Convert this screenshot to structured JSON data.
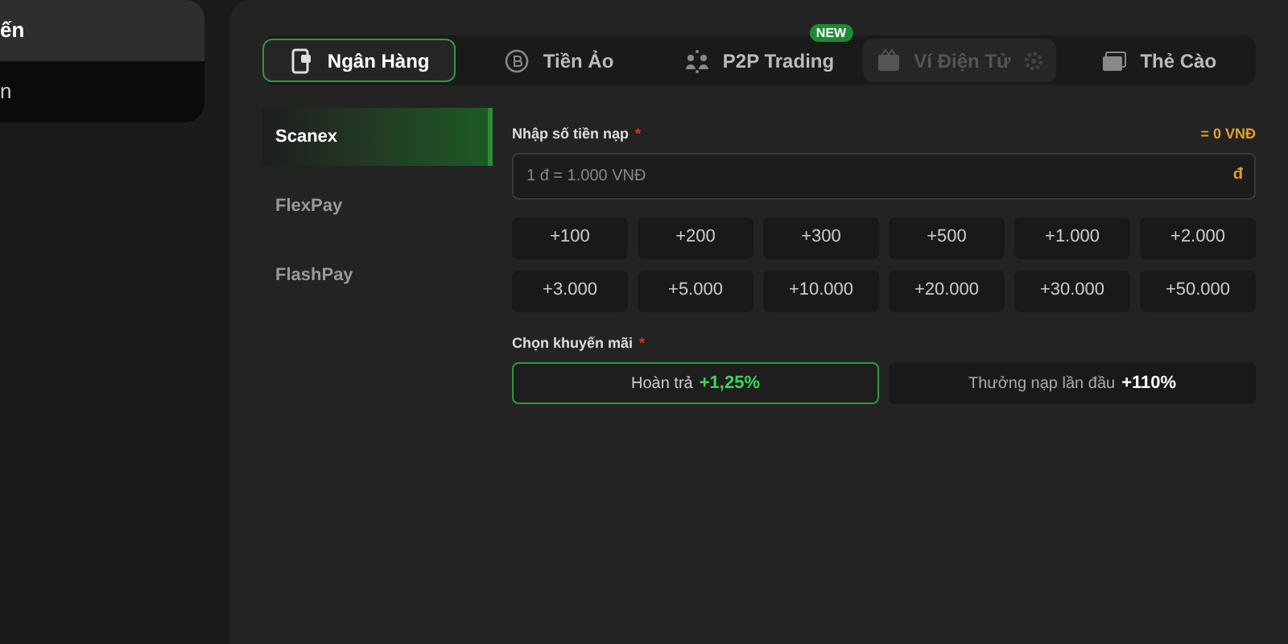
{
  "sidebar": {
    "items": [
      {
        "label": "ến",
        "selected": true
      },
      {
        "label": "n",
        "selected": false
      }
    ]
  },
  "tabs": [
    {
      "label": "Ngân Hàng",
      "selected": true,
      "disabled": false
    },
    {
      "label": "Tiền Ảo",
      "selected": false,
      "disabled": false
    },
    {
      "label": "P2P Trading",
      "selected": false,
      "disabled": false,
      "badge": "NEW"
    },
    {
      "label": "Ví Điện Tử",
      "selected": false,
      "disabled": true
    },
    {
      "label": "Thẻ Cào",
      "selected": false,
      "disabled": false
    }
  ],
  "methods": [
    {
      "label": "Scanex",
      "selected": true
    },
    {
      "label": "FlexPay",
      "selected": false
    },
    {
      "label": "FlashPay",
      "selected": false
    }
  ],
  "amount": {
    "label": "Nhập số tiền nạp",
    "required_mark": "*",
    "converted": "= 0 VNĐ",
    "placeholder": "1 đ = 1.000 VNĐ",
    "suffix": "đ"
  },
  "quick_amounts": [
    "+100",
    "+200",
    "+300",
    "+500",
    "+1.000",
    "+2.000",
    "+3.000",
    "+5.000",
    "+10.000",
    "+20.000",
    "+30.000",
    "+50.000"
  ],
  "promotion": {
    "label": "Chọn khuyến mãi",
    "required_mark": "*",
    "options": [
      {
        "label": "Hoàn trả",
        "bonus": "+1,25%",
        "selected": true
      },
      {
        "label": "Thưởng nạp lần đầu",
        "bonus": "+110%",
        "selected": false
      }
    ]
  }
}
